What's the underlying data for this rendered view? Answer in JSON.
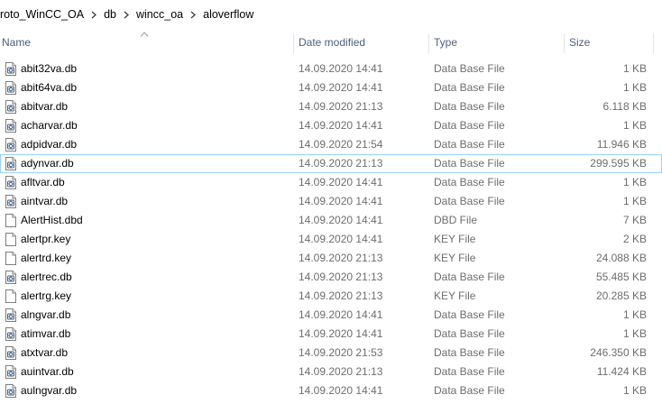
{
  "breadcrumb": [
    "roto_WinCC_OA",
    "db",
    "wincc_oa",
    "aloverflow"
  ],
  "columns": {
    "name": "Name",
    "date": "Date modified",
    "type": "Type",
    "size": "Size"
  },
  "sort": {
    "column": "name",
    "direction": "ascending"
  },
  "selected_file": "adynvar.db",
  "files": [
    {
      "name": "abit32va.db",
      "date": "14.09.2020 14:41",
      "type": "Data Base File",
      "size": "1 KB",
      "icon": "database-file-icon"
    },
    {
      "name": "abit64va.db",
      "date": "14.09.2020 14:41",
      "type": "Data Base File",
      "size": "1 KB",
      "icon": "database-file-icon"
    },
    {
      "name": "abitvar.db",
      "date": "14.09.2020 21:13",
      "type": "Data Base File",
      "size": "6.118 KB",
      "icon": "database-file-icon"
    },
    {
      "name": "acharvar.db",
      "date": "14.09.2020 14:41",
      "type": "Data Base File",
      "size": "1 KB",
      "icon": "database-file-icon"
    },
    {
      "name": "adpidvar.db",
      "date": "14.09.2020 21:54",
      "type": "Data Base File",
      "size": "11.946 KB",
      "icon": "database-file-icon"
    },
    {
      "name": "adynvar.db",
      "date": "14.09.2020 21:13",
      "type": "Data Base File",
      "size": "299.595 KB",
      "icon": "database-file-icon"
    },
    {
      "name": "afltvar.db",
      "date": "14.09.2020 14:41",
      "type": "Data Base File",
      "size": "1 KB",
      "icon": "database-file-icon"
    },
    {
      "name": "aintvar.db",
      "date": "14.09.2020 14:41",
      "type": "Data Base File",
      "size": "1 KB",
      "icon": "database-file-icon"
    },
    {
      "name": "AlertHist.dbd",
      "date": "14.09.2020 14:41",
      "type": "DBD File",
      "size": "7 KB",
      "icon": "blank-file-icon"
    },
    {
      "name": "alertpr.key",
      "date": "14.09.2020 14:41",
      "type": "KEY File",
      "size": "2 KB",
      "icon": "blank-file-icon"
    },
    {
      "name": "alertrd.key",
      "date": "14.09.2020 21:13",
      "type": "KEY File",
      "size": "24.088 KB",
      "icon": "blank-file-icon"
    },
    {
      "name": "alertrec.db",
      "date": "14.09.2020 21:13",
      "type": "Data Base File",
      "size": "55.485 KB",
      "icon": "database-file-icon"
    },
    {
      "name": "alertrg.key",
      "date": "14.09.2020 21:13",
      "type": "KEY File",
      "size": "20.285 KB",
      "icon": "blank-file-icon"
    },
    {
      "name": "alngvar.db",
      "date": "14.09.2020 14:41",
      "type": "Data Base File",
      "size": "1 KB",
      "icon": "database-file-icon"
    },
    {
      "name": "atimvar.db",
      "date": "14.09.2020 14:41",
      "type": "Data Base File",
      "size": "1 KB",
      "icon": "database-file-icon"
    },
    {
      "name": "atxtvar.db",
      "date": "14.09.2020 21:53",
      "type": "Data Base File",
      "size": "246.350 KB",
      "icon": "database-file-icon"
    },
    {
      "name": "auintvar.db",
      "date": "14.09.2020 21:13",
      "type": "Data Base File",
      "size": "11.424 KB",
      "icon": "database-file-icon"
    },
    {
      "name": "aulngvar.db",
      "date": "14.09.2020 14:41",
      "type": "Data Base File",
      "size": "1 KB",
      "icon": "database-file-icon"
    }
  ]
}
